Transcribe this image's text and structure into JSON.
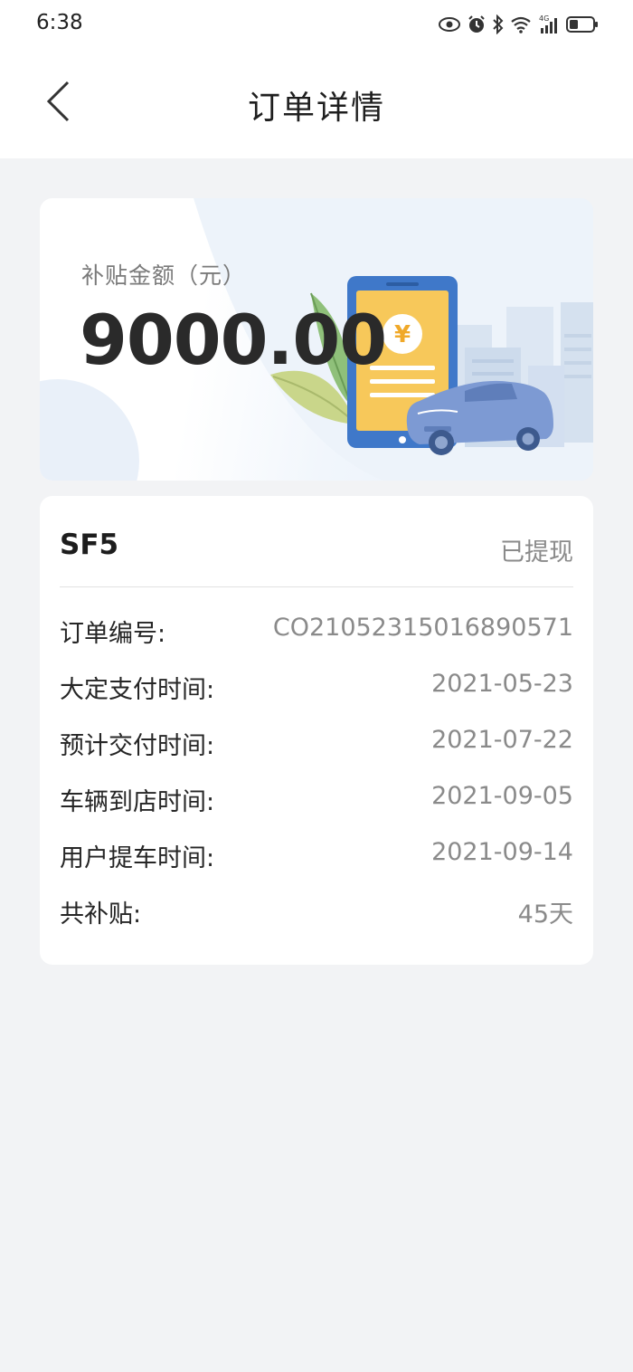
{
  "status_bar": {
    "time": "6:38",
    "icons": [
      "eye-icon",
      "alarm-icon",
      "bluetooth-icon",
      "wifi-icon",
      "signal-icon",
      "battery-icon"
    ],
    "network_label": "4G"
  },
  "nav": {
    "title": "订单详情",
    "back_icon": "chevron-left-icon"
  },
  "banner": {
    "label": "补贴金额（元）",
    "amount": "9000.00",
    "illustration": "phone-yuan-car-illustration"
  },
  "order": {
    "model": "SF5",
    "status": "已提现",
    "rows": [
      {
        "key": "订单编号:",
        "value": "CO21052315016890571"
      },
      {
        "key": "大定支付时间:",
        "value": "2021-05-23"
      },
      {
        "key": "预计交付时间:",
        "value": "2021-07-22"
      },
      {
        "key": "车辆到店时间:",
        "value": "2021-09-05"
      },
      {
        "key": "用户提车时间:",
        "value": "2021-09-14"
      },
      {
        "key": "共补贴:",
        "value": "45天"
      }
    ]
  },
  "colors": {
    "background": "#f2f3f5",
    "card": "#ffffff",
    "phone_blue": "#3f78c9",
    "phone_screen": "#f7c85a",
    "car_blue": "#7d9ad3"
  }
}
